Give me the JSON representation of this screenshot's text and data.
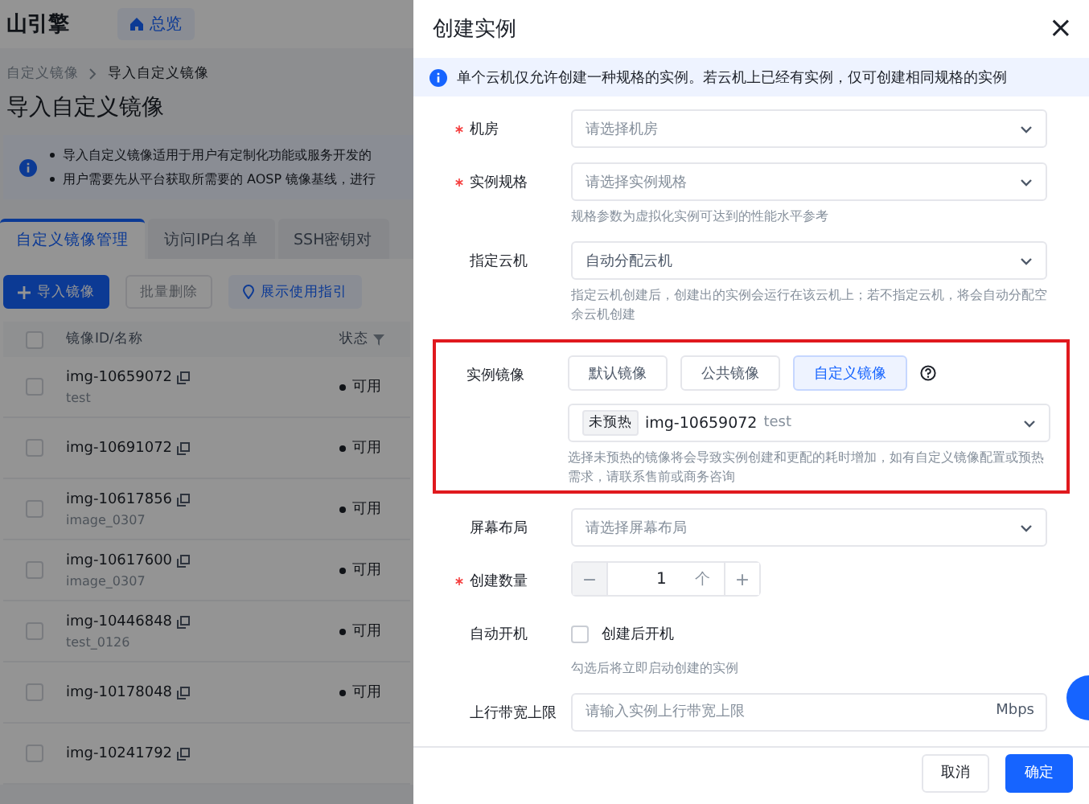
{
  "topbar": {
    "brand": "山引擎",
    "home": "总览"
  },
  "breadcrumb": [
    "自定义镜像",
    "导入自定义镜像"
  ],
  "page_title": "导入自定义镜像",
  "notice": [
    "导入自定义镜像适用于用户有定制化功能或服务开发的",
    "用户需要先从平台获取所需要的 AOSP 镜像基线，进行"
  ],
  "tabs": [
    {
      "label": "自定义镜像管理",
      "selected": true
    },
    {
      "label": "访问IP白名单",
      "selected": false
    },
    {
      "label": "SSH密钥对",
      "selected": false
    }
  ],
  "actions": [
    {
      "kind": "primary",
      "label": "导入镜像"
    },
    {
      "kind": "plain",
      "label": "批量删除",
      "disabled": true
    },
    {
      "kind": "guide",
      "label": "展示使用指引"
    }
  ],
  "table": {
    "columns": [
      "镜像ID/名称",
      "状态"
    ],
    "all_checked": false,
    "rows": [
      {
        "id": "img-10659072",
        "name": "test",
        "status": "可用",
        "checked": false
      },
      {
        "id": "img-10691072",
        "status": "可用",
        "checked": false
      },
      {
        "id": "img-10617856",
        "name": "image_0307",
        "status": "可用",
        "checked": false
      },
      {
        "id": "img-10617600",
        "name": "image_0307",
        "status": "可用",
        "checked": false
      },
      {
        "id": "img-10446848",
        "name": "test_0126",
        "status": "可用",
        "checked": false
      },
      {
        "id": "img-10178048",
        "status": "可用",
        "checked": false
      },
      {
        "id": "img-10241792",
        "checked": false
      }
    ]
  },
  "drawer": {
    "title": "创建实例",
    "close": "×",
    "alert": "单个云机仅允许创建一种规格的实例。若云机上已经有实例，仅可创建相同规格的实例",
    "items": [
      {
        "kind": "select",
        "label": "机房",
        "required": true,
        "placeholder": "请选择机房"
      },
      {
        "kind": "select",
        "label": "实例规格",
        "required": true,
        "placeholder": "请选择实例规格",
        "hint": "规格参数为虚拟化实例可达到的性能水平参考"
      },
      {
        "kind": "select",
        "label": "指定云机",
        "required": false,
        "value": "自动分配云机",
        "hint": "指定云机创建后，创建出的实例会运行在该云机上；若不指定云机，将会自动分配空余云机创建"
      },
      {
        "kind": "image",
        "label": "实例镜像",
        "required": false,
        "highlighted": true,
        "options": [
          {
            "label": "默认镜像",
            "selected": false
          },
          {
            "label": "公共镜像",
            "selected": false
          },
          {
            "label": "自定义镜像",
            "selected": true
          }
        ],
        "tag": "未预热",
        "image_id": "img-10659072",
        "image_name": "test",
        "hint": "选择未预热的镜像将会导致实例创建和更配的耗时增加，如有自定义镜像配置或预热需求，请联系售前或商务咨询"
      },
      {
        "kind": "select",
        "label": "屏幕布局",
        "required": false,
        "placeholder": "请选择屏幕布局"
      },
      {
        "kind": "stepper",
        "label": "创建数量",
        "required": true,
        "decrement": "−",
        "value": "1",
        "unit": "个",
        "increment": "+"
      },
      {
        "kind": "checkbox",
        "label": "自动开机",
        "required": false,
        "option": "创建后开机",
        "checked": false,
        "hint": "勾选后将立即启动创建的实例"
      },
      {
        "kind": "input",
        "label": "上行带宽上限",
        "required": false,
        "placeholder": "请输入实例上行带宽上限",
        "suffix": "Mbps"
      }
    ],
    "buttons": [
      {
        "kind": "plain",
        "label": "取消"
      },
      {
        "kind": "primary",
        "label": "确定"
      }
    ]
  }
}
